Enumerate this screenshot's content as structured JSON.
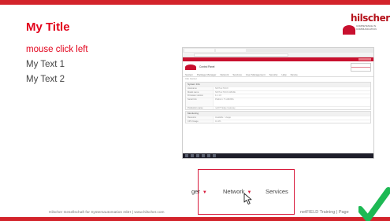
{
  "slide": {
    "title": "My Title",
    "bullets": [
      "mouse click left",
      "My Text 1",
      "My Text 2"
    ],
    "footer_left": "Hilscher Gesellschaft für Systemautomation mbH | www.hilscher.com",
    "footer_right": "netFIELD Training | Page"
  },
  "logo": {
    "brand": "hilscher",
    "tagline": "COMPETENCE IN COMMUNICATION"
  },
  "screenshot": {
    "app_name": "Control Panel",
    "nav": [
      "System",
      "Package Manager",
      "Network",
      "Services",
      "User Management",
      "Security",
      "Help",
      "Device"
    ],
    "breadcrumb": "Info Center",
    "section1": "System Info",
    "rows": [
      {
        "key": "Hostname",
        "value": "NIOT-E-TIJCX"
      },
      {
        "key": "Model name",
        "value": "NIOT-E-TIJCX-GB-RE"
      },
      {
        "key": "Firmware version",
        "value": "1.1.1.0"
      },
      {
        "key": "Serial Info",
        "value": "Platform: TI-AM335x"
      },
      {
        "key": "Production name",
        "value": "netIOT Edge Gateway"
      }
    ],
    "section2": "Monitoring",
    "mon_headers": [
      "Resource",
      "Available",
      "Usage"
    ],
    "mon_rows": [
      {
        "key": "CPU Usage",
        "value": "41.1%"
      }
    ]
  },
  "zoom": {
    "items": [
      {
        "label": "ger",
        "has_caret": true
      },
      {
        "label": "Network",
        "has_caret": true
      },
      {
        "label": "Services",
        "has_caret": false
      }
    ]
  },
  "colors": {
    "accent": "#e2001a",
    "brand_red": "#c8102e",
    "check": "#1db954"
  }
}
